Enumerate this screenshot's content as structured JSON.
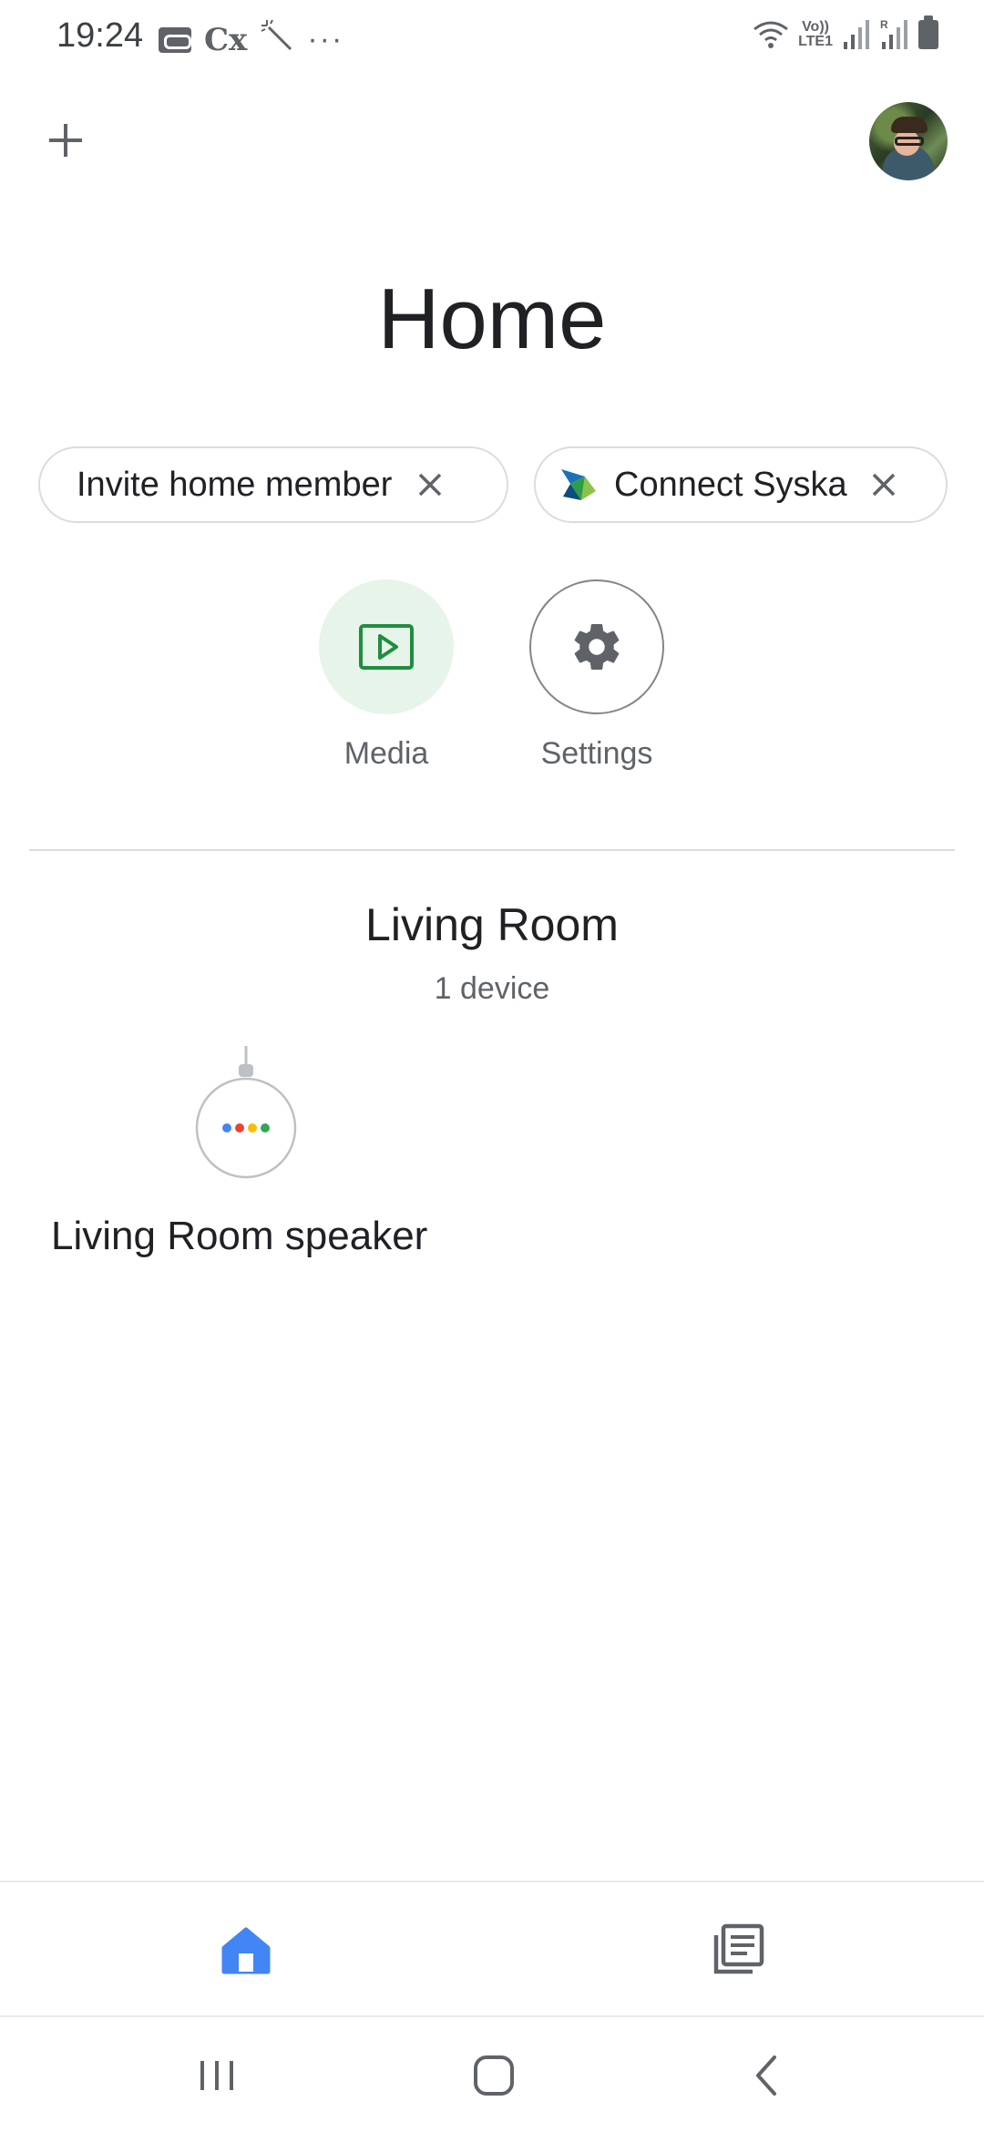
{
  "status_bar": {
    "time": "19:24",
    "left_icons": [
      "voicemail-icon",
      "cx-icon",
      "magic-wand-icon",
      "more-dots"
    ],
    "cx_text": "Cx",
    "more_text": "···",
    "lte_line1": "Vo))",
    "lte_line2": "LTE1",
    "right_icons": [
      "wifi-icon",
      "lte-icon",
      "signal-icon",
      "signal-roaming-icon",
      "battery-icon"
    ]
  },
  "top_bar": {
    "add_icon": "plus-icon",
    "avatar_icon": "account-avatar"
  },
  "page": {
    "title": "Home"
  },
  "chips": [
    {
      "label": "Invite home member",
      "close_icon": "close-icon"
    },
    {
      "label": "Connect Syska",
      "logo": "syska-logo",
      "close_icon": "close-icon"
    }
  ],
  "actions": [
    {
      "label": "Media",
      "icon": "media-play-icon"
    },
    {
      "label": "Settings",
      "icon": "gear-icon"
    }
  ],
  "room": {
    "name": "Living Room",
    "device_count": "1 device",
    "devices": [
      {
        "label": "Living Room speaker",
        "icon": "speaker-icon"
      }
    ]
  },
  "bottom_nav": [
    {
      "name": "home",
      "icon": "home-icon",
      "active": true
    },
    {
      "name": "feed",
      "icon": "feed-icon",
      "active": false
    }
  ],
  "system_nav": [
    "recents-icon",
    "home-button-icon",
    "back-icon"
  ],
  "colors": {
    "accent_blue": "#4285f4",
    "media_green": "#1e8e3e",
    "media_bg": "#e6f4ea",
    "text_primary": "#202124",
    "text_secondary": "#5f6368",
    "dot_blue": "#4285f4",
    "dot_red": "#ea4335",
    "dot_yellow": "#fbbc04",
    "dot_green": "#34a853"
  }
}
